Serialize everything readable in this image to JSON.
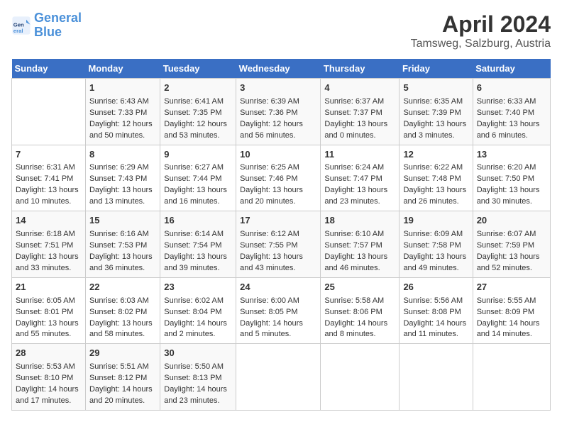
{
  "logo": {
    "line1": "General",
    "line2": "Blue"
  },
  "title": "April 2024",
  "subtitle": "Tamsweg, Salzburg, Austria",
  "days_of_week": [
    "Sunday",
    "Monday",
    "Tuesday",
    "Wednesday",
    "Thursday",
    "Friday",
    "Saturday"
  ],
  "weeks": [
    [
      {
        "num": "",
        "sunrise": "",
        "sunset": "",
        "daylight": ""
      },
      {
        "num": "1",
        "sunrise": "Sunrise: 6:43 AM",
        "sunset": "Sunset: 7:33 PM",
        "daylight": "Daylight: 12 hours and 50 minutes."
      },
      {
        "num": "2",
        "sunrise": "Sunrise: 6:41 AM",
        "sunset": "Sunset: 7:35 PM",
        "daylight": "Daylight: 12 hours and 53 minutes."
      },
      {
        "num": "3",
        "sunrise": "Sunrise: 6:39 AM",
        "sunset": "Sunset: 7:36 PM",
        "daylight": "Daylight: 12 hours and 56 minutes."
      },
      {
        "num": "4",
        "sunrise": "Sunrise: 6:37 AM",
        "sunset": "Sunset: 7:37 PM",
        "daylight": "Daylight: 13 hours and 0 minutes."
      },
      {
        "num": "5",
        "sunrise": "Sunrise: 6:35 AM",
        "sunset": "Sunset: 7:39 PM",
        "daylight": "Daylight: 13 hours and 3 minutes."
      },
      {
        "num": "6",
        "sunrise": "Sunrise: 6:33 AM",
        "sunset": "Sunset: 7:40 PM",
        "daylight": "Daylight: 13 hours and 6 minutes."
      }
    ],
    [
      {
        "num": "7",
        "sunrise": "Sunrise: 6:31 AM",
        "sunset": "Sunset: 7:41 PM",
        "daylight": "Daylight: 13 hours and 10 minutes."
      },
      {
        "num": "8",
        "sunrise": "Sunrise: 6:29 AM",
        "sunset": "Sunset: 7:43 PM",
        "daylight": "Daylight: 13 hours and 13 minutes."
      },
      {
        "num": "9",
        "sunrise": "Sunrise: 6:27 AM",
        "sunset": "Sunset: 7:44 PM",
        "daylight": "Daylight: 13 hours and 16 minutes."
      },
      {
        "num": "10",
        "sunrise": "Sunrise: 6:25 AM",
        "sunset": "Sunset: 7:46 PM",
        "daylight": "Daylight: 13 hours and 20 minutes."
      },
      {
        "num": "11",
        "sunrise": "Sunrise: 6:24 AM",
        "sunset": "Sunset: 7:47 PM",
        "daylight": "Daylight: 13 hours and 23 minutes."
      },
      {
        "num": "12",
        "sunrise": "Sunrise: 6:22 AM",
        "sunset": "Sunset: 7:48 PM",
        "daylight": "Daylight: 13 hours and 26 minutes."
      },
      {
        "num": "13",
        "sunrise": "Sunrise: 6:20 AM",
        "sunset": "Sunset: 7:50 PM",
        "daylight": "Daylight: 13 hours and 30 minutes."
      }
    ],
    [
      {
        "num": "14",
        "sunrise": "Sunrise: 6:18 AM",
        "sunset": "Sunset: 7:51 PM",
        "daylight": "Daylight: 13 hours and 33 minutes."
      },
      {
        "num": "15",
        "sunrise": "Sunrise: 6:16 AM",
        "sunset": "Sunset: 7:53 PM",
        "daylight": "Daylight: 13 hours and 36 minutes."
      },
      {
        "num": "16",
        "sunrise": "Sunrise: 6:14 AM",
        "sunset": "Sunset: 7:54 PM",
        "daylight": "Daylight: 13 hours and 39 minutes."
      },
      {
        "num": "17",
        "sunrise": "Sunrise: 6:12 AM",
        "sunset": "Sunset: 7:55 PM",
        "daylight": "Daylight: 13 hours and 43 minutes."
      },
      {
        "num": "18",
        "sunrise": "Sunrise: 6:10 AM",
        "sunset": "Sunset: 7:57 PM",
        "daylight": "Daylight: 13 hours and 46 minutes."
      },
      {
        "num": "19",
        "sunrise": "Sunrise: 6:09 AM",
        "sunset": "Sunset: 7:58 PM",
        "daylight": "Daylight: 13 hours and 49 minutes."
      },
      {
        "num": "20",
        "sunrise": "Sunrise: 6:07 AM",
        "sunset": "Sunset: 7:59 PM",
        "daylight": "Daylight: 13 hours and 52 minutes."
      }
    ],
    [
      {
        "num": "21",
        "sunrise": "Sunrise: 6:05 AM",
        "sunset": "Sunset: 8:01 PM",
        "daylight": "Daylight: 13 hours and 55 minutes."
      },
      {
        "num": "22",
        "sunrise": "Sunrise: 6:03 AM",
        "sunset": "Sunset: 8:02 PM",
        "daylight": "Daylight: 13 hours and 58 minutes."
      },
      {
        "num": "23",
        "sunrise": "Sunrise: 6:02 AM",
        "sunset": "Sunset: 8:04 PM",
        "daylight": "Daylight: 14 hours and 2 minutes."
      },
      {
        "num": "24",
        "sunrise": "Sunrise: 6:00 AM",
        "sunset": "Sunset: 8:05 PM",
        "daylight": "Daylight: 14 hours and 5 minutes."
      },
      {
        "num": "25",
        "sunrise": "Sunrise: 5:58 AM",
        "sunset": "Sunset: 8:06 PM",
        "daylight": "Daylight: 14 hours and 8 minutes."
      },
      {
        "num": "26",
        "sunrise": "Sunrise: 5:56 AM",
        "sunset": "Sunset: 8:08 PM",
        "daylight": "Daylight: 14 hours and 11 minutes."
      },
      {
        "num": "27",
        "sunrise": "Sunrise: 5:55 AM",
        "sunset": "Sunset: 8:09 PM",
        "daylight": "Daylight: 14 hours and 14 minutes."
      }
    ],
    [
      {
        "num": "28",
        "sunrise": "Sunrise: 5:53 AM",
        "sunset": "Sunset: 8:10 PM",
        "daylight": "Daylight: 14 hours and 17 minutes."
      },
      {
        "num": "29",
        "sunrise": "Sunrise: 5:51 AM",
        "sunset": "Sunset: 8:12 PM",
        "daylight": "Daylight: 14 hours and 20 minutes."
      },
      {
        "num": "30",
        "sunrise": "Sunrise: 5:50 AM",
        "sunset": "Sunset: 8:13 PM",
        "daylight": "Daylight: 14 hours and 23 minutes."
      },
      {
        "num": "",
        "sunrise": "",
        "sunset": "",
        "daylight": ""
      },
      {
        "num": "",
        "sunrise": "",
        "sunset": "",
        "daylight": ""
      },
      {
        "num": "",
        "sunrise": "",
        "sunset": "",
        "daylight": ""
      },
      {
        "num": "",
        "sunrise": "",
        "sunset": "",
        "daylight": ""
      }
    ]
  ]
}
